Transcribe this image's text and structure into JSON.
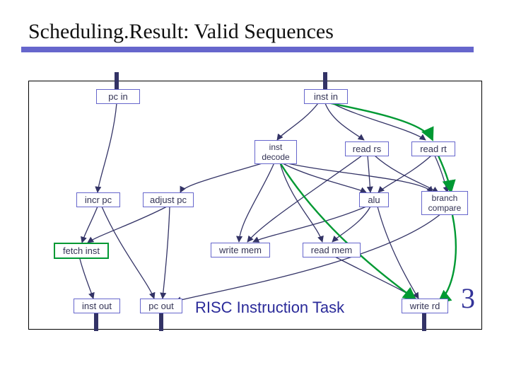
{
  "title": "Scheduling.Result: Valid Sequences",
  "nodes": {
    "pc_in": "pc in",
    "inst_in": "inst in",
    "inst_decode": "inst\ndecode",
    "read_rs": "read rs",
    "read_rt": "read rt",
    "incr_pc": "incr pc",
    "adjust_pc": "adjust pc",
    "alu": "alu",
    "branch_compare": "branch\ncompare",
    "fetch_inst": "fetch inst",
    "write_mem": "write mem",
    "read_mem": "read mem",
    "inst_out": "inst out",
    "pc_out": "pc out",
    "write_rd": "write rd"
  },
  "caption": "RISC Instruction Task",
  "page": "3"
}
